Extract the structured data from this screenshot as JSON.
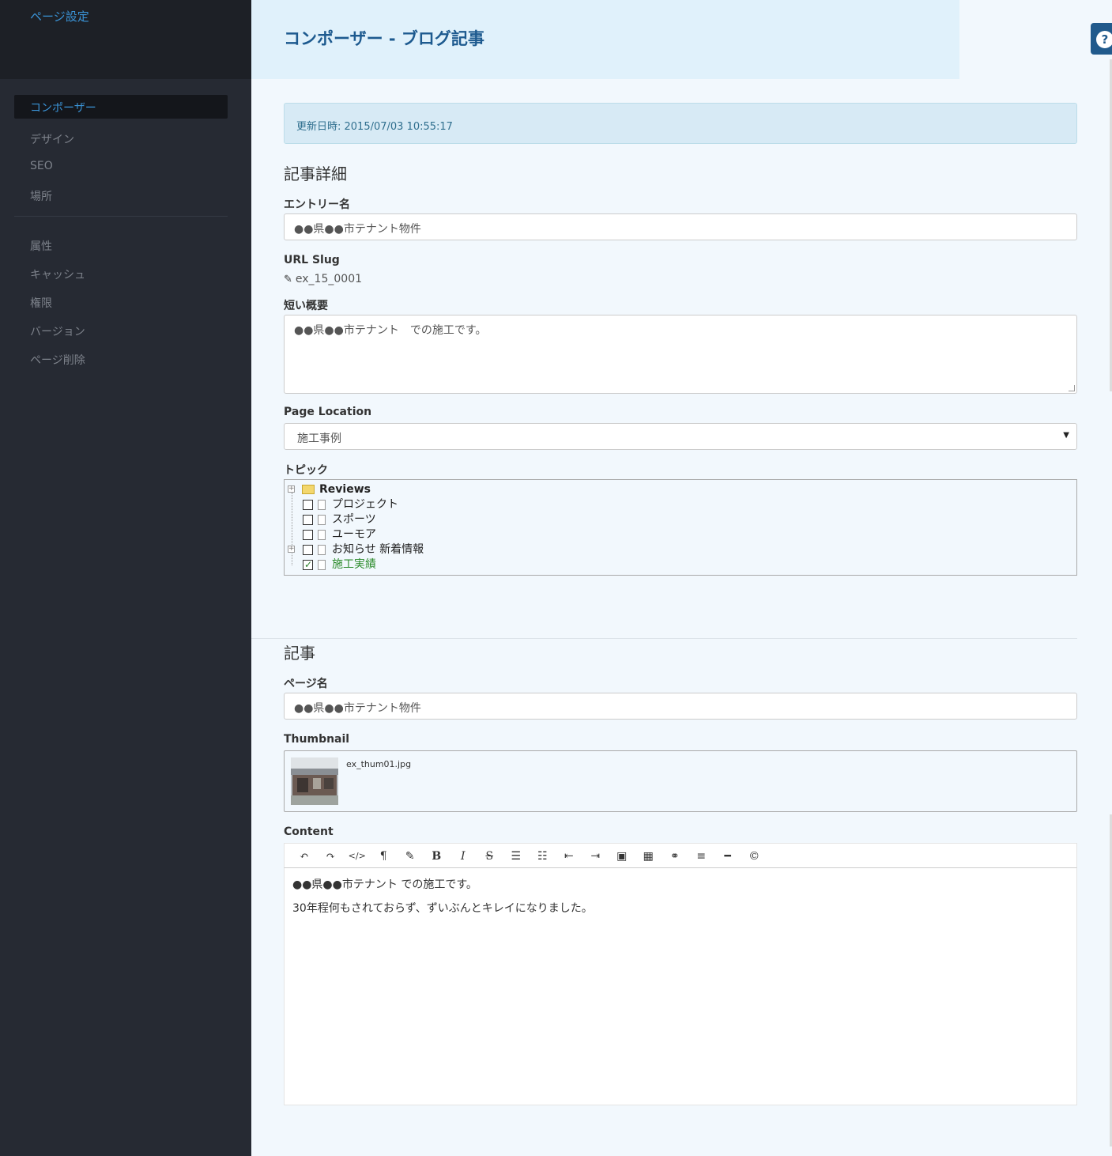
{
  "sidebar": {
    "title": "ページ設定",
    "items": [
      {
        "label": "コンポーザー"
      },
      {
        "label": "デザイン"
      },
      {
        "label": "SEO"
      },
      {
        "label": "場所"
      },
      {
        "label": "属性"
      },
      {
        "label": "キャッシュ"
      },
      {
        "label": "権限"
      },
      {
        "label": "バージョン"
      },
      {
        "label": "ページ削除"
      }
    ]
  },
  "header": {
    "title": "コンポーザー - ブログ記事",
    "help_icon": "?"
  },
  "alert": {
    "text": "更新日時: 2015/07/03 10:55:17"
  },
  "details": {
    "heading": "記事詳細",
    "entry_label": "エントリー名",
    "entry_value": "●●県●●市テナント物件",
    "slug_label": "URL Slug",
    "slug_value": "ex_15_0001",
    "summary_label": "短い概要",
    "summary_value": "●●県●●市テナント　での施工です。",
    "location_label": "Page Location",
    "location_value": "施工事例",
    "topics_label": "トピック",
    "topics": {
      "root": "Reviews",
      "items": [
        {
          "label": "プロジェクト",
          "checked": false
        },
        {
          "label": "スポーツ",
          "checked": false
        },
        {
          "label": "ユーモア",
          "checked": false
        },
        {
          "label": "お知らせ 新着情報",
          "checked": false
        },
        {
          "label": "施工実績",
          "checked": true
        }
      ]
    }
  },
  "article": {
    "heading": "記事",
    "page_name_label": "ページ名",
    "page_name_value": "●●県●●市テナント物件",
    "thumb_label": "Thumbnail",
    "thumb_file": "ex_thum01.jpg",
    "content_label": "Content",
    "toolbar": [
      "↶",
      "↷",
      "</>",
      "¶",
      "✎",
      "B",
      "I",
      "S",
      "☰",
      "☷",
      "⇤",
      "⇥",
      "▣",
      "▦",
      "⚭",
      "≡",
      "━",
      "©"
    ],
    "content_lines": [
      "●●県●●市テナント での施工です。",
      "30年程何もされておらず、ずいぶんとキレイになりました。"
    ]
  }
}
